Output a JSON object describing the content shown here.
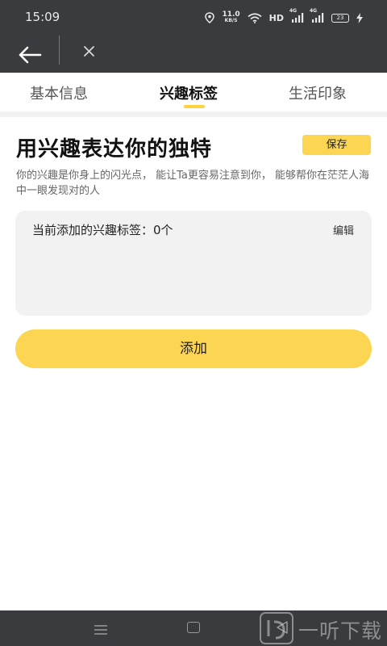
{
  "status_bar": {
    "time": "15:09",
    "net_speed_value": "11.0",
    "net_speed_unit": "KB/S",
    "hd": "HD",
    "signal_1": "4G",
    "signal_2": "4G",
    "battery": "23",
    "icons": [
      "location-icon",
      "wifi-icon",
      "signal-icon",
      "charging-icon"
    ]
  },
  "nav": {
    "back_icon": "arrow-left-icon",
    "close_icon": "close-icon"
  },
  "tabs": [
    {
      "label": "基本信息",
      "active": false
    },
    {
      "label": "兴趣标签",
      "active": true
    },
    {
      "label": "生活印象",
      "active": false
    }
  ],
  "main": {
    "heading": "用兴趣表达你的独特",
    "save_label": "保存",
    "description": "你的兴趣是你身上的闪光点， 能让Ta更容易注意到你， 能够帮你在茫茫人海中一眼发现对的人",
    "tag_count_label": "当前添加的兴趣标签：0个",
    "edit_label": "编辑",
    "add_label": "添加"
  },
  "watermark": {
    "text": "一听下载"
  },
  "colors": {
    "accent": "#fcd552",
    "indicator": "#fcd23f",
    "dark_bar": "#3a3b3e",
    "card_bg": "#f2f2f2"
  }
}
